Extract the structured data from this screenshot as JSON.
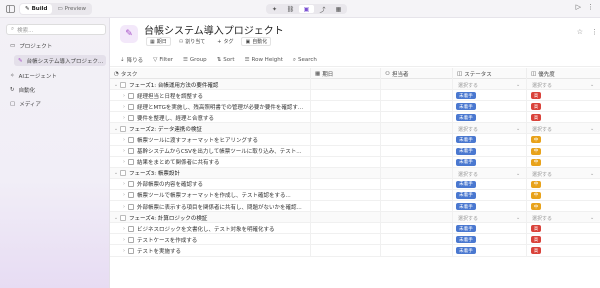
{
  "topbar": {
    "build_label": "Build",
    "preview_label": "Preview",
    "tools": [
      {
        "icon": "lightbulb-icon",
        "glyph": "✦"
      },
      {
        "icon": "link-icon",
        "glyph": "⛓"
      },
      {
        "icon": "app-icon",
        "glyph": "▣"
      },
      {
        "icon": "share-icon",
        "glyph": "⤴"
      },
      {
        "icon": "grid-icon",
        "glyph": "▦"
      }
    ],
    "right_icons": [
      {
        "icon": "play-icon",
        "glyph": "▷"
      },
      {
        "icon": "more-icon",
        "glyph": "⋮"
      }
    ]
  },
  "sidebar": {
    "search_placeholder": "検索...",
    "items": [
      {
        "label": "プロジェクト",
        "icon": "folder-icon",
        "glyph": "▭"
      },
      {
        "label": "台帳システム導入プロジェク...",
        "icon": "project-icon",
        "glyph": "✎",
        "active": true
      },
      {
        "label": "AIエージェント",
        "icon": "ai-icon",
        "glyph": "✧"
      },
      {
        "label": "自動化",
        "icon": "automation-icon",
        "glyph": "↻"
      },
      {
        "label": "メディア",
        "icon": "media-icon",
        "glyph": "▢"
      }
    ]
  },
  "project": {
    "title": "台帳システム導入プロジェクト",
    "chips": [
      {
        "label": "期日",
        "icon": "calendar-icon",
        "glyph": "▦"
      },
      {
        "label": "割り当て",
        "icon": "people-icon",
        "glyph": "⚇"
      },
      {
        "label": "タグ",
        "icon": "plus-icon",
        "glyph": "+"
      },
      {
        "label": "自動化",
        "icon": "automation-icon",
        "glyph": "▣"
      }
    ],
    "star_glyph": "☆",
    "more_glyph": "⋮"
  },
  "viewbar": [
    {
      "label": "降りる",
      "icon": "sort-desc-icon",
      "glyph": "⇣"
    },
    {
      "label": "Filter",
      "icon": "filter-icon",
      "glyph": "▽"
    },
    {
      "label": "Group",
      "icon": "group-icon",
      "glyph": "☰"
    },
    {
      "label": "Sort",
      "icon": "sort-icon",
      "glyph": "⇅"
    },
    {
      "label": "Row Height",
      "icon": "row-height-icon",
      "glyph": "☰"
    },
    {
      "label": "Search",
      "icon": "search-icon",
      "glyph": "⌕"
    }
  ],
  "columns": {
    "task": "タスク",
    "due": "期日",
    "assignee": "担当者",
    "status": "ステータス",
    "priority": "優先度"
  },
  "select_placeholder": "選択する",
  "status_label": "未着手",
  "priority_colors": {
    "高": "#d9423a",
    "中": "#e8a21a"
  },
  "rows": [
    {
      "type": "group",
      "name": "フェーズ1: 台帳運用方法の要件確認"
    },
    {
      "type": "task",
      "name": "経理担当と日程を調整する",
      "priority": "高"
    },
    {
      "type": "task",
      "name": "経理とMTGを実施し、残高照明書での管理が必要か要件を確認す...",
      "priority": "高"
    },
    {
      "type": "task",
      "name": "要件を整理し、経理と合意する",
      "priority": "高"
    },
    {
      "type": "group",
      "name": "フェーズ2: データ連携の検証"
    },
    {
      "type": "task",
      "name": "帳票ツールに渡すフォーマットをヒアリングする",
      "priority": "中"
    },
    {
      "type": "task",
      "name": "基幹システムからCSVを出力して帳票ツールに取り込み、テスト...",
      "priority": "中"
    },
    {
      "type": "task",
      "name": "結果をまとめて関係者に共有する",
      "priority": "中"
    },
    {
      "type": "group",
      "name": "フェーズ3: 帳票設計"
    },
    {
      "type": "task",
      "name": "外部帳票の内容を確認する",
      "priority": "中"
    },
    {
      "type": "task",
      "name": "帳票ツールで帳票フォーマットを作成し、テスト確認をする...",
      "priority": "中"
    },
    {
      "type": "task",
      "name": "外部帳票に表示する項目を関係者に共有し、問題がないかを確認...",
      "priority": "中"
    },
    {
      "type": "group",
      "name": "フェーズ4: 計算ロジックの検証"
    },
    {
      "type": "task",
      "name": "ビジネスロジックを文書化し、テスト対象を明確化する",
      "priority": "高"
    },
    {
      "type": "task",
      "name": "テストケースを作成する",
      "priority": "高"
    },
    {
      "type": "task",
      "name": "テストを実施する",
      "priority": "高"
    }
  ]
}
